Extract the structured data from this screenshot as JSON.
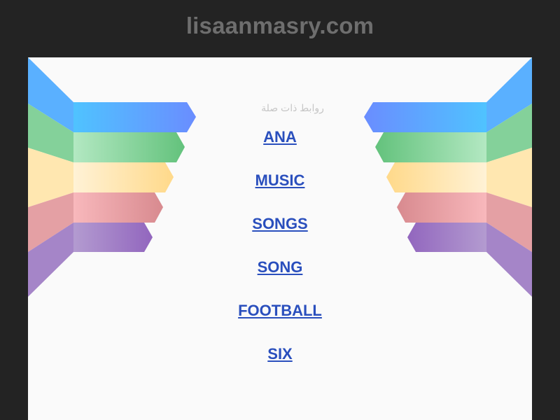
{
  "site": {
    "title": "lisaanmasry.com"
  },
  "related": {
    "label": "روابط ذات صلة"
  },
  "links": [
    {
      "label": "ANA"
    },
    {
      "label": "MUSIC"
    },
    {
      "label": "SONGS"
    },
    {
      "label": "SONG"
    },
    {
      "label": "FOOTBALL"
    },
    {
      "label": "SIX"
    }
  ],
  "colors": {
    "background": "#232323",
    "panel": "#fafafa",
    "title": "#6e6e6e",
    "link": "#2a4fbd",
    "ribbon_blue": "#5aa8ff",
    "ribbon_green": "#6fcf8a",
    "ribbon_yellow": "#ffe3a0",
    "ribbon_pink": "#e99aa0",
    "ribbon_purple": "#9b74c4"
  }
}
